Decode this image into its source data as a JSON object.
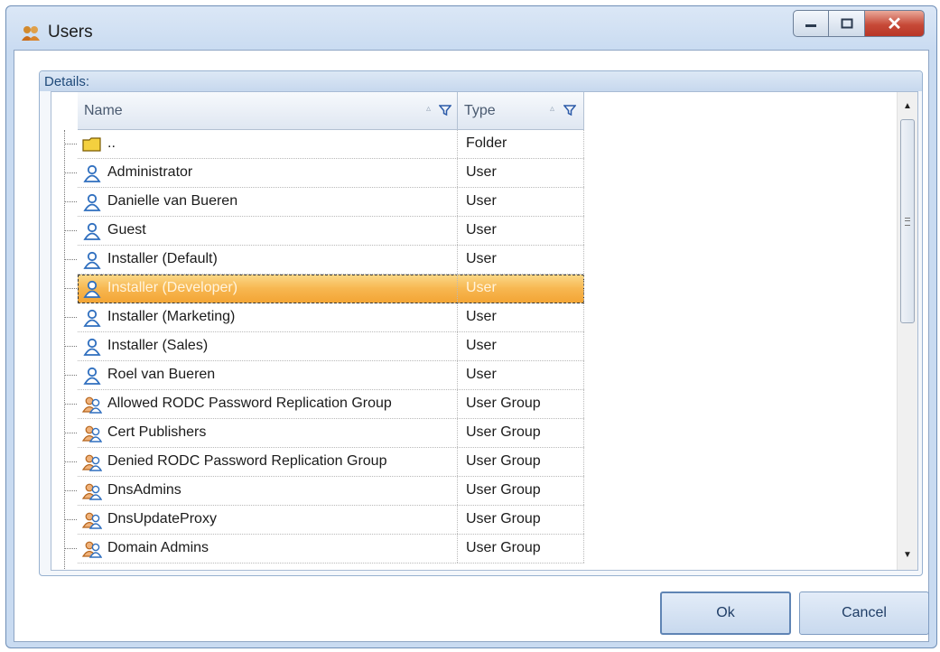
{
  "window": {
    "title": "Users",
    "icon": "users-group-icon",
    "controls": {
      "minimize": "minimize-icon",
      "maximize": "maximize-icon",
      "close": "✕"
    }
  },
  "details": {
    "label": "Details:",
    "columns": [
      {
        "label": "Name",
        "sort_icon": "sort-icon",
        "filter_icon": "filter-icon"
      },
      {
        "label": "Type",
        "sort_icon": "sort-icon",
        "filter_icon": "filter-icon"
      }
    ],
    "rows": [
      {
        "name": "..",
        "type": "Folder",
        "icon": "folder-icon"
      },
      {
        "name": "Administrator",
        "type": "User",
        "icon": "user-icon"
      },
      {
        "name": "Danielle van Bueren",
        "type": "User",
        "icon": "user-icon"
      },
      {
        "name": "Guest",
        "type": "User",
        "icon": "user-icon"
      },
      {
        "name": "Installer (Default)",
        "type": "User",
        "icon": "user-icon"
      },
      {
        "name": "Installer (Developer)",
        "type": "User",
        "icon": "user-icon",
        "selected": true
      },
      {
        "name": "Installer (Marketing)",
        "type": "User",
        "icon": "user-icon"
      },
      {
        "name": "Installer (Sales)",
        "type": "User",
        "icon": "user-icon"
      },
      {
        "name": "Roel van Bueren",
        "type": "User",
        "icon": "user-icon"
      },
      {
        "name": "Allowed RODC Password Replication Group",
        "type": "User Group",
        "icon": "user-group-icon"
      },
      {
        "name": "Cert Publishers",
        "type": "User Group",
        "icon": "user-group-icon"
      },
      {
        "name": "Denied RODC Password Replication Group",
        "type": "User Group",
        "icon": "user-group-icon"
      },
      {
        "name": "DnsAdmins",
        "type": "User Group",
        "icon": "user-group-icon"
      },
      {
        "name": "DnsUpdateProxy",
        "type": "User Group",
        "icon": "user-group-icon"
      },
      {
        "name": "Domain Admins",
        "type": "User Group",
        "icon": "user-group-icon"
      }
    ]
  },
  "buttons": {
    "ok": "Ok",
    "cancel": "Cancel"
  },
  "colors": {
    "selection": "#f7b751",
    "accent": "#c9dbf1",
    "close_button": "#c74a38"
  }
}
